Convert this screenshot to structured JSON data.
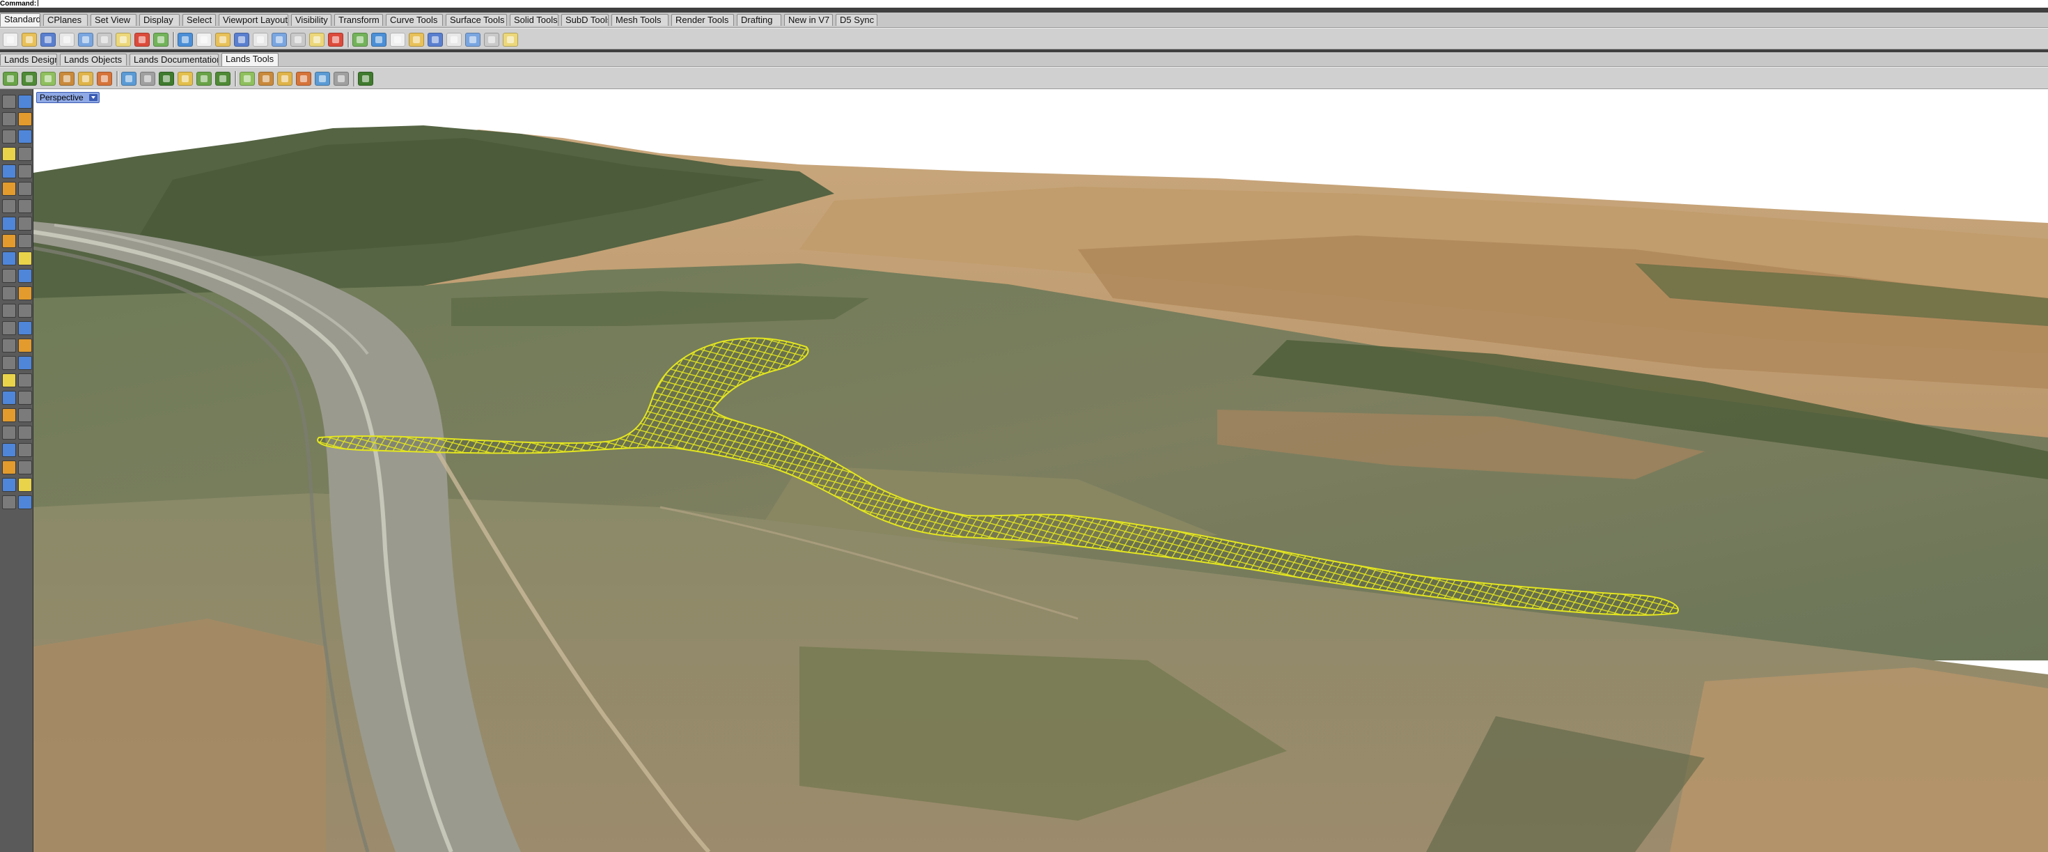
{
  "command": {
    "prompt": "Command:"
  },
  "tabs_main": [
    "Standard",
    "CPlanes",
    "Set View",
    "Display",
    "Select",
    "Viewport Layout",
    "Visibility",
    "Transform",
    "Curve Tools",
    "Surface Tools",
    "Solid Tools",
    "SubD Tools",
    "Mesh Tools",
    "Render Tools",
    "Drafting",
    "New in V7",
    "D5 Sync"
  ],
  "tabs_lands": [
    "Lands Design",
    "Lands Objects",
    "Lands Documentation",
    "Lands Tools"
  ],
  "active_tab_main": "Standard",
  "active_tab_lands": "Lands Tools",
  "viewport": {
    "title": "Perspective",
    "menu_icon": "chevron-down-icon"
  },
  "colors": {
    "mesh_wireframe": "#e4e61f",
    "viewport_title_bg": "#8fa9e6",
    "sky": "#ffffff"
  },
  "toolbar_icons": {
    "standard": [
      "new-file-icon",
      "open-icon",
      "save-icon",
      "print-icon",
      "import-icon",
      "cut-icon",
      "copy-icon",
      "paste-icon",
      "undo-icon",
      "pan-icon",
      "rotate-view-icon",
      "zoom-icon",
      "zoom-window-icon",
      "zoom-extents-icon",
      "zoom-selected-icon",
      "four-viewports-icon",
      "select-icon",
      "hide-icon",
      "show-icon",
      "lock-icon",
      "layer-icon",
      "properties-icon",
      "render-icon",
      "material-icon",
      "display-mode-icon",
      "lighting-icon",
      "help-icon"
    ],
    "lands": [
      "plant-icon",
      "tree-icon",
      "shrub-icon",
      "hedge-icon",
      "groundcover-icon",
      "planting-area-icon",
      "fence-icon",
      "path-icon",
      "terrain-icon",
      "paving-icon",
      "water-icon",
      "furniture-icon",
      "lighting-fixture-icon",
      "elevation-icon",
      "contour-icon",
      "measure-icon",
      "export-icon",
      "report-icon",
      "image-icon"
    ]
  }
}
